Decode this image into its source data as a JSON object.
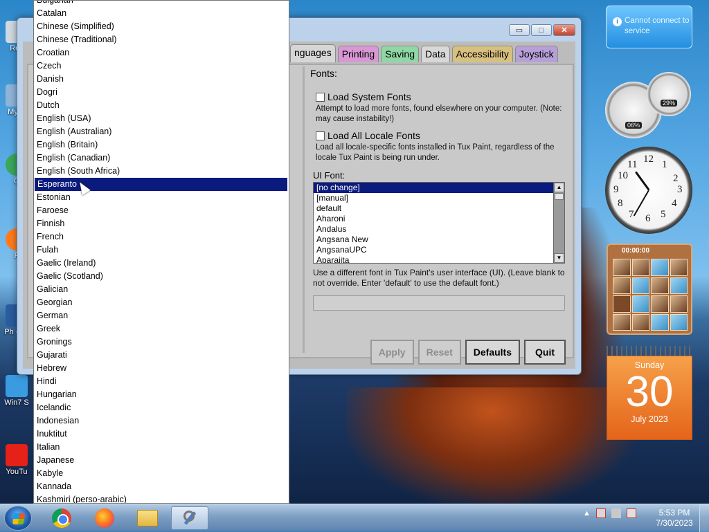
{
  "window": {
    "controls": {
      "minimize": "▭",
      "maximize": "□",
      "close": "✕"
    },
    "tabs": [
      "nguages",
      "Printing",
      "Saving",
      "Data",
      "Accessibility",
      "Joystick"
    ],
    "fonts": {
      "title": "Fonts:",
      "load_system": {
        "label": "Load System Fonts",
        "desc": "Attempt to load more fonts, found elsewhere on your computer. (Note: may cause instability!)"
      },
      "load_locale": {
        "label": "Load All Locale Fonts",
        "desc": "Load all locale-specific fonts installed in Tux Paint, regardless of the locale Tux Paint is being run under."
      },
      "ui_font_label": "UI Font:",
      "ui_font_options": [
        "[no change]",
        "[manual]",
        "default",
        "Aharoni",
        "Andalus",
        "Angsana New",
        "AngsanaUPC",
        "Aparajita"
      ],
      "ui_font_selected": "[no change]",
      "ui_font_desc": "Use a different font in Tux Paint's user interface (UI). (Leave blank to not override. Enter 'default' to use the default font.)",
      "ui_font_input_value": ""
    },
    "buttons": {
      "apply": "Apply",
      "reset": "Reset",
      "defaults": "Defaults",
      "quit": "Quit"
    }
  },
  "language_dropdown": {
    "selected": "Esperanto",
    "items": [
      "Bulgarian",
      "Catalan",
      "Chinese (Simplified)",
      "Chinese (Traditional)",
      "Croatian",
      "Czech",
      "Danish",
      "Dogri",
      "Dutch",
      "English (USA)",
      "English (Australian)",
      "English (Britain)",
      "English (Canadian)",
      "English (South Africa)",
      "Esperanto",
      "Estonian",
      "Faroese",
      "Finnish",
      "French",
      "Fulah",
      "Gaelic (Ireland)",
      "Gaelic (Scotland)",
      "Galician",
      "Georgian",
      "German",
      "Greek",
      "Gronings",
      "Gujarati",
      "Hebrew",
      "Hindi",
      "Hungarian",
      "Icelandic",
      "Indonesian",
      "Inuktitut",
      "Italian",
      "Japanese",
      "Kabyle",
      "Kannada",
      "Kashmiri (perso-arabic)"
    ]
  },
  "desktop": {
    "icons": [
      {
        "name": "recycle-bin-icon",
        "label": "Rec"
      },
      {
        "name": "my-computer-icon",
        "label": "My C"
      },
      {
        "name": "chrome-shortcut-icon",
        "label": "C"
      },
      {
        "name": "firefox-shortcut-icon",
        "label": "F"
      },
      {
        "name": "phone-shortcut-icon",
        "label": "Ph -Mo"
      },
      {
        "name": "win7-shortcut-icon",
        "label": "Win7 S"
      },
      {
        "name": "youtube-shortcut-icon",
        "label": "YouTu"
      }
    ]
  },
  "gadgets": {
    "notification": {
      "text": "Cannot connect to service"
    },
    "cpu_gauge": {
      "cpu_percent": "06%",
      "memory_percent": "29%"
    },
    "clock_numbers": [
      "12",
      "1",
      "2",
      "3",
      "4",
      "5",
      "6",
      "7",
      "8",
      "9",
      "10",
      "11"
    ],
    "puzzle_timer": "00:00:00",
    "calendar": {
      "weekday": "Sunday",
      "day": "30",
      "month_year": "July 2023"
    }
  },
  "taskbar": {
    "time": "5:53 PM",
    "date": "7/30/2023",
    "apps": [
      "start-button",
      "chrome",
      "firefox",
      "file-explorer",
      "tux-paint-config"
    ]
  },
  "colors": {
    "selection": "#0a1a7d",
    "tab_printing": "#d997d4",
    "tab_saving": "#8fd7a4",
    "tab_accessibility": "#d8c080",
    "tab_joystick": "#b7a0d8",
    "calendar": "#e4641a"
  }
}
